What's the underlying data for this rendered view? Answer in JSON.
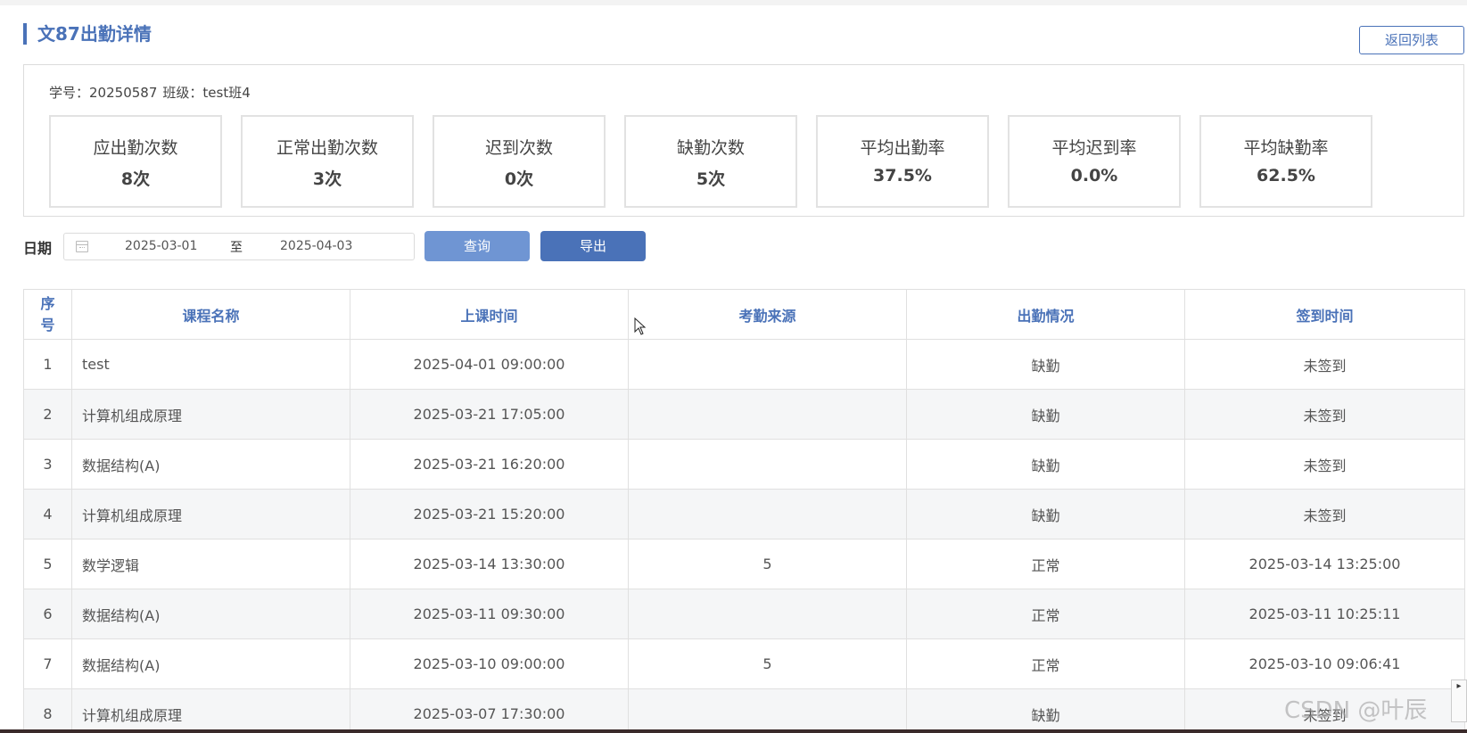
{
  "header": {
    "title": "文87出勤详情",
    "back_button": "返回列表"
  },
  "student": {
    "id_label": "学号：",
    "id": "20250587",
    "class_label": "班级：",
    "class": "test班4"
  },
  "stats": [
    {
      "label": "应出勤次数",
      "value": "8次"
    },
    {
      "label": "正常出勤次数",
      "value": "3次"
    },
    {
      "label": "迟到次数",
      "value": "0次"
    },
    {
      "label": "缺勤次数",
      "value": "5次"
    },
    {
      "label": "平均出勤率",
      "value": "37.5%"
    },
    {
      "label": "平均迟到率",
      "value": "0.0%"
    },
    {
      "label": "平均缺勤率",
      "value": "62.5%"
    }
  ],
  "filter": {
    "label": "日期",
    "start_date": "2025-03-01",
    "separator": "至",
    "end_date": "2025-04-03",
    "query_button": "查询",
    "export_button": "导出"
  },
  "table": {
    "headers": {
      "index": "序号",
      "course": "课程名称",
      "class_time": "上课时间",
      "source": "考勤来源",
      "status": "出勤情况",
      "checkin_time": "签到时间"
    },
    "rows": [
      {
        "index": "1",
        "course": "test",
        "class_time": "2025-04-01 09:00:00",
        "source": "",
        "status": "缺勤",
        "checkin_time": "未签到"
      },
      {
        "index": "2",
        "course": "计算机组成原理",
        "class_time": "2025-03-21 17:05:00",
        "source": "",
        "status": "缺勤",
        "checkin_time": "未签到"
      },
      {
        "index": "3",
        "course": "数据结构(A)",
        "class_time": "2025-03-21 16:20:00",
        "source": "",
        "status": "缺勤",
        "checkin_time": "未签到"
      },
      {
        "index": "4",
        "course": "计算机组成原理",
        "class_time": "2025-03-21 15:20:00",
        "source": "",
        "status": "缺勤",
        "checkin_time": "未签到"
      },
      {
        "index": "5",
        "course": "数学逻辑",
        "class_time": "2025-03-14 13:30:00",
        "source": "5",
        "status": "正常",
        "checkin_time": "2025-03-14 13:25:00"
      },
      {
        "index": "6",
        "course": "数据结构(A)",
        "class_time": "2025-03-11 09:30:00",
        "source": "",
        "status": "正常",
        "checkin_time": "2025-03-11 10:25:11"
      },
      {
        "index": "7",
        "course": "数据结构(A)",
        "class_time": "2025-03-10 09:00:00",
        "source": "5",
        "status": "正常",
        "checkin_time": "2025-03-10 09:06:41"
      },
      {
        "index": "8",
        "course": "计算机组成原理",
        "class_time": "2025-03-07 17:30:00",
        "source": "",
        "status": "缺勤",
        "checkin_time": "未签到"
      }
    ]
  },
  "watermark": "CSDN @叶辰",
  "colors": {
    "accent": "#4a72b8",
    "query_button": "#6f95d3"
  }
}
